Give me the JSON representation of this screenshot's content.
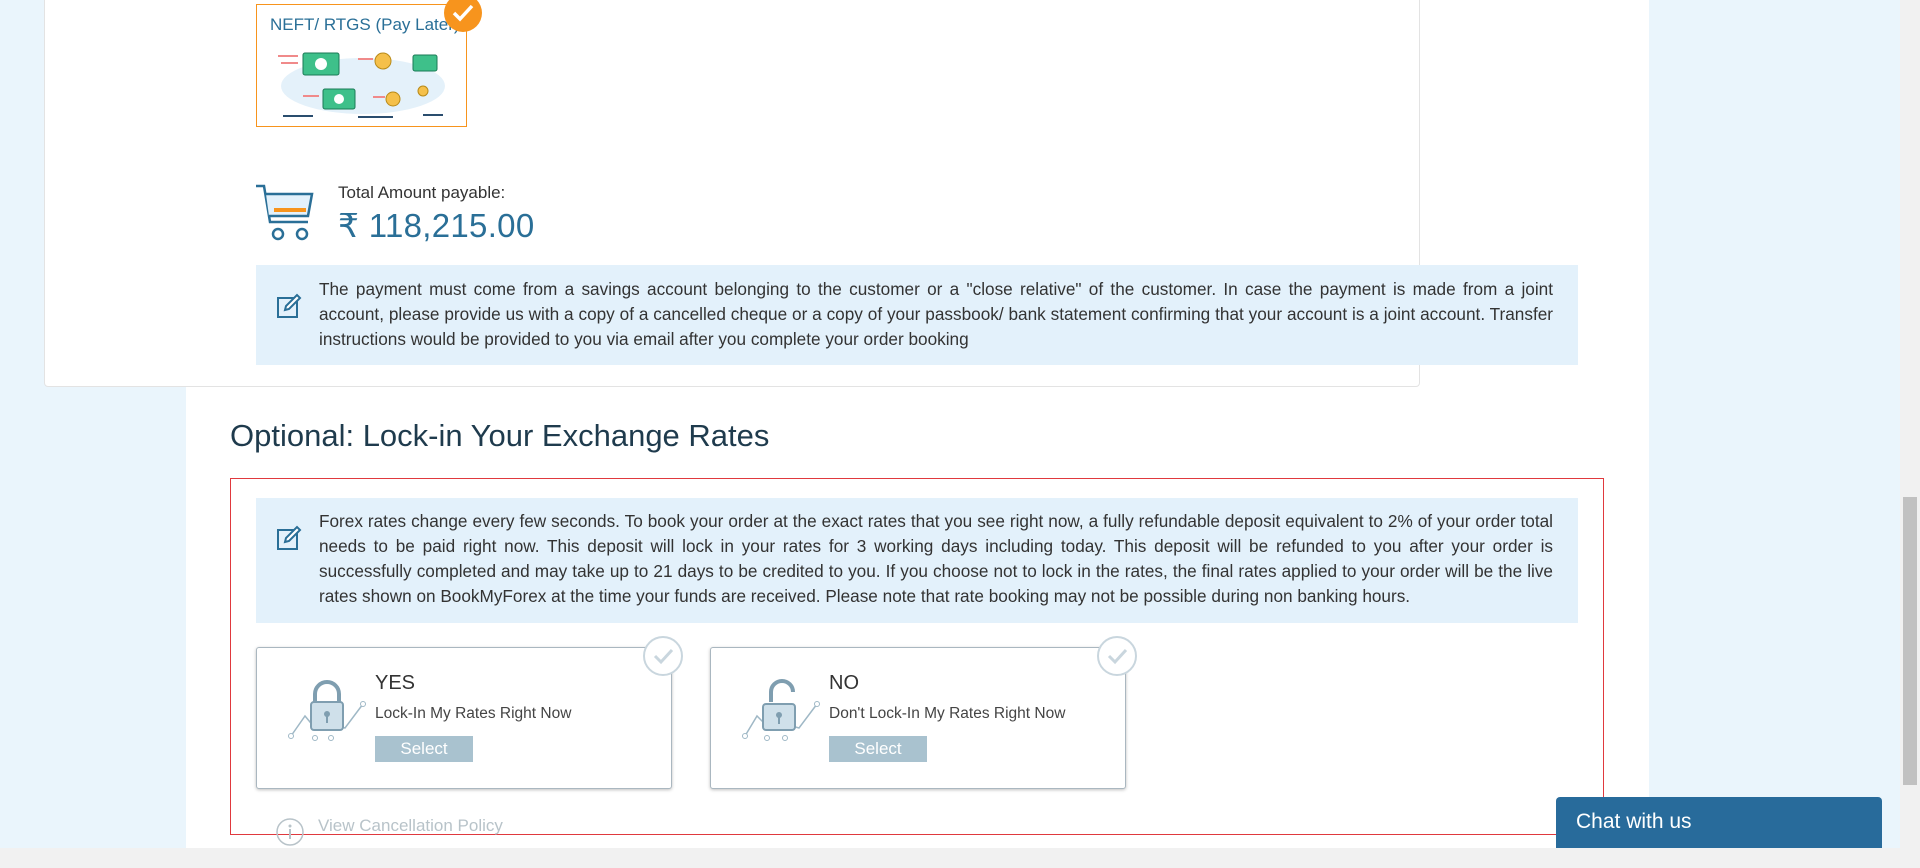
{
  "payment": {
    "method_label": "NEFT/ RTGS (Pay Later)",
    "total_label": "Total Amount payable:",
    "total_amount": "₹ 118,215.00",
    "note": "The payment must come from a savings account belonging to the customer or a \"close relative\" of the customer. In case the payment is made from a joint account, please provide us with a copy of a cancelled cheque or a copy of your passbook/ bank statement confirming that your account is a joint account. Transfer instructions would be provided to you via email after you complete your order booking"
  },
  "lockin": {
    "title": "Optional: Lock-in Your Exchange Rates",
    "note": "Forex rates change every few seconds. To book your order at the exact rates that you see right now, a fully refundable deposit equivalent to 2% of your order total needs to be paid right now. This deposit will lock in your rates for 3 working days including today. This deposit will be refunded to you after your order is successfully completed and may take up to 21 days to be credited to you. If you choose not to lock in the rates, the final rates applied to your order will be the live rates shown on BookMyForex at the time your funds are received. Please note that rate booking may not be possible during non banking hours.",
    "options": [
      {
        "title": "YES",
        "subtitle": "Lock-In My Rates Right Now",
        "button": "Select"
      },
      {
        "title": "NO",
        "subtitle": "Don't Lock-In My Rates Right Now",
        "button": "Select"
      }
    ],
    "policy_link": "View Cancellation Policy"
  },
  "chat": {
    "label": "Chat with us"
  },
  "colors": {
    "accent": "#2a6f97",
    "orange": "#f7941d",
    "note_bg": "#e3f1fb",
    "border_red": "#e0393e"
  }
}
